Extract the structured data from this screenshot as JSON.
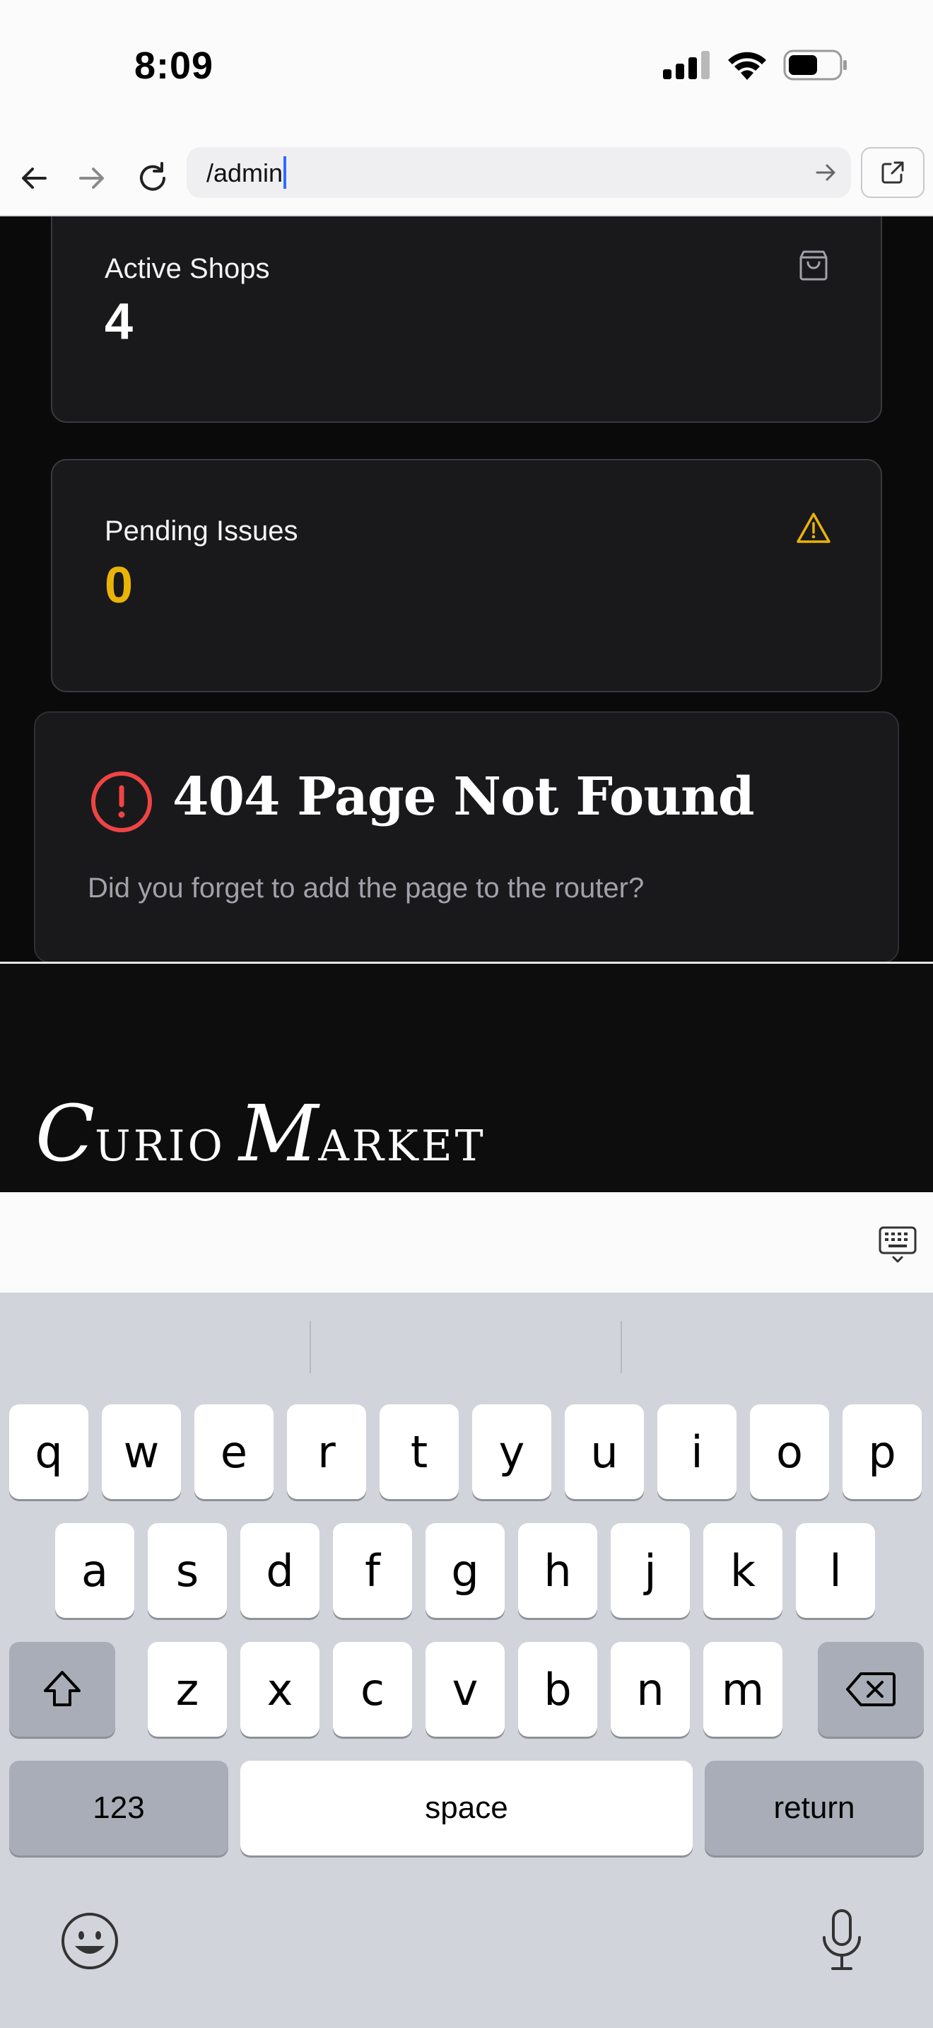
{
  "status_bar": {
    "time": "8:09"
  },
  "browser": {
    "url": "/admin",
    "icons": {
      "back": "arrow-left-icon",
      "forward": "arrow-right-icon",
      "reload": "reload-icon",
      "go": "arrow-right-icon",
      "open_external": "external-link-icon"
    }
  },
  "stats": [
    {
      "label": "Active Shops",
      "value": "4",
      "icon": "shopping-bag-icon",
      "value_color": "#ffffff"
    },
    {
      "label": "Pending Issues",
      "value": "0",
      "icon": "warning-triangle-icon",
      "value_color": "#eab308"
    }
  ],
  "not_found": {
    "title": "404 Page Not Found",
    "message": "Did you forget to add the page to the router?",
    "icon": "alert-circle-icon",
    "icon_color": "#ef4444"
  },
  "footer": {
    "brand_big_1": "C",
    "brand_small_1": "URIO",
    "brand_big_2": "M",
    "brand_small_2": "ARKET"
  },
  "keyboard": {
    "row1": [
      "q",
      "w",
      "e",
      "r",
      "t",
      "y",
      "u",
      "i",
      "o",
      "p"
    ],
    "row2": [
      "a",
      "s",
      "d",
      "f",
      "g",
      "h",
      "j",
      "k",
      "l"
    ],
    "row3": [
      "z",
      "x",
      "c",
      "v",
      "b",
      "n",
      "m"
    ],
    "numbers_label": "123",
    "space_label": "space",
    "return_label": "return"
  },
  "colors": {
    "accent_yellow": "#eab308",
    "error_red": "#ef4444",
    "caret_blue": "#2f6bff"
  }
}
